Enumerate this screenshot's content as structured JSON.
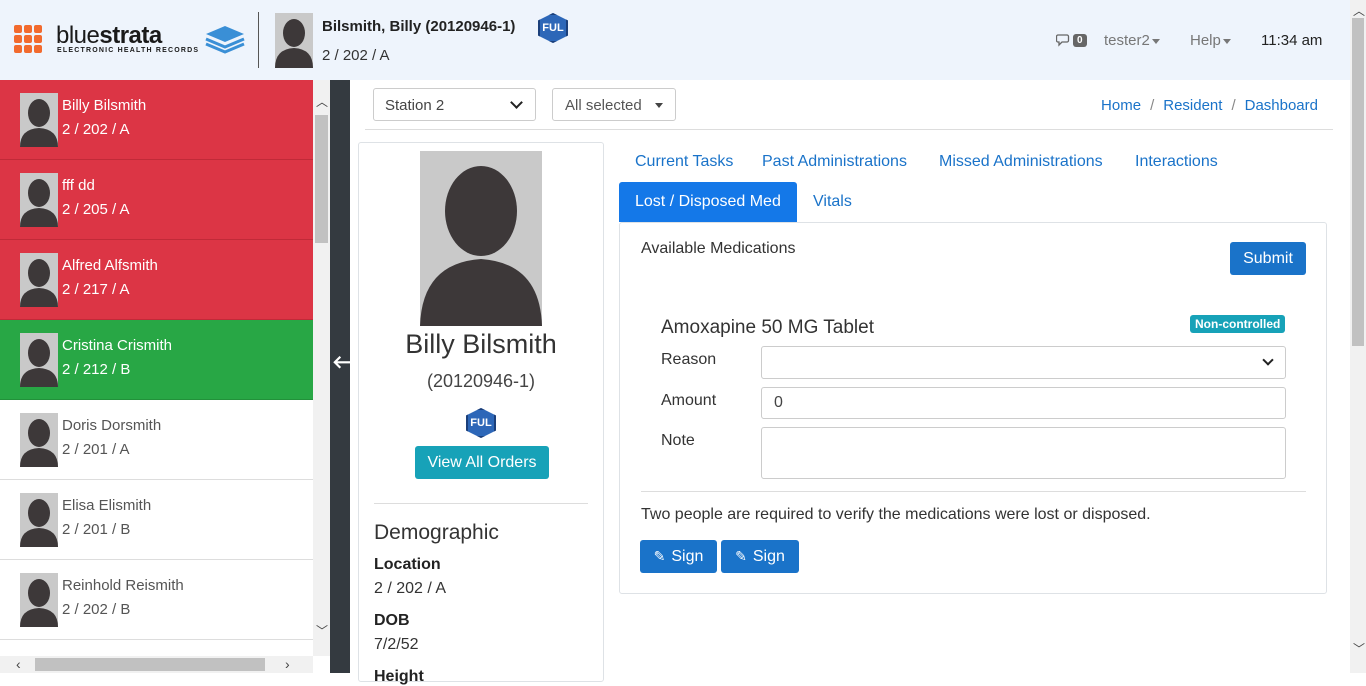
{
  "header": {
    "logo_word": "blue",
    "logo_word_bold": "strata",
    "logo_sub": "ELECTRONIC HEALTH RECORDS",
    "resident_name": "Bilsmith, Billy (20120946-1)",
    "resident_location": "2 / 202 / A",
    "ful_badge": "FUL",
    "message_count": "0",
    "user": "tester2",
    "help": "Help",
    "time": "11:34 am"
  },
  "sidebar": {
    "residents": [
      {
        "name": "Billy Bilsmith",
        "location": "2 / 202 / A",
        "status": "red"
      },
      {
        "name": "fff dd",
        "location": "2 / 205 / A",
        "status": "red"
      },
      {
        "name": "Alfred Alfsmith",
        "location": "2 / 217 / A",
        "status": "red"
      },
      {
        "name": "Cristina Crismith",
        "location": "2 / 212 / B",
        "status": "green"
      },
      {
        "name": "Doris Dorsmith",
        "location": "2 / 201 / A",
        "status": "none"
      },
      {
        "name": "Elisa Elismith",
        "location": "2 / 201 / B",
        "status": "none"
      },
      {
        "name": "Reinhold Reismith",
        "location": "2 / 202 / B",
        "status": "none"
      }
    ],
    "status_colors": {
      "red": "#dc3545",
      "green": "#28a745"
    }
  },
  "filters": {
    "station": "Station 2",
    "selection": "All selected"
  },
  "breadcrumb": [
    "Home",
    "Resident",
    "Dashboard"
  ],
  "profile": {
    "name": "Billy Bilsmith",
    "id": "(20120946-1)",
    "ful_badge": "FUL",
    "view_orders": "View All Orders",
    "demographic_title": "Demographic",
    "location_label": "Location",
    "location_value": "2 / 202 / A",
    "dob_label": "DOB",
    "dob_value": "7/2/52",
    "height_label": "Height"
  },
  "tabs": [
    {
      "label": "Current Tasks",
      "active": false
    },
    {
      "label": "Past Administrations",
      "active": false
    },
    {
      "label": "Missed Administrations",
      "active": false
    },
    {
      "label": "Interactions",
      "active": false
    },
    {
      "label": "Lost / Disposed Med",
      "active": true
    },
    {
      "label": "Vitals",
      "active": false
    }
  ],
  "panel": {
    "title": "Available Medications",
    "submit": "Submit",
    "medication": "Amoxapine 50 MG Tablet",
    "control_badge": "Non-controlled",
    "reason_label": "Reason",
    "reason_value": "",
    "amount_label": "Amount",
    "amount_value": "0",
    "note_label": "Note",
    "note_value": "",
    "verify_text": "Two people are required to verify the medications were lost or disposed.",
    "sign_1": "Sign",
    "sign_2": "Sign"
  },
  "colors": {
    "accent": "#1a73c9",
    "active_tab": "#1478e8",
    "info": "#17a2b8",
    "sidebar_dark": "#343a40",
    "apps_icon": "#f26a2e"
  }
}
